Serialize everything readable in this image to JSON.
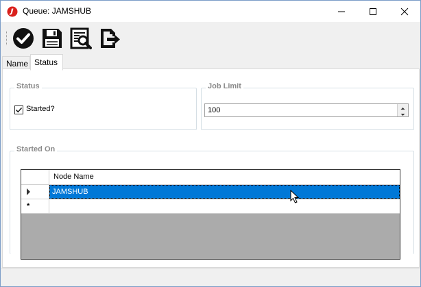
{
  "window": {
    "title": "Queue: JAMSHUB"
  },
  "titlebar_buttons": [
    {
      "name": "minimize"
    },
    {
      "name": "maximize"
    },
    {
      "name": "close"
    }
  ],
  "toolbar": {
    "items": [
      {
        "icon": "checkmark-icon"
      },
      {
        "icon": "save-icon"
      },
      {
        "icon": "search-report-icon"
      },
      {
        "icon": "export-icon"
      }
    ]
  },
  "tabs": [
    {
      "label": "Name",
      "active": false
    },
    {
      "label": "Status",
      "active": true
    }
  ],
  "status_group": {
    "title": "Status",
    "started_checkbox": {
      "label": "Started?",
      "checked": true
    }
  },
  "job_limit_group": {
    "title": "Job Limit",
    "value": "100"
  },
  "started_on_group": {
    "title": "Started On",
    "grid": {
      "columns": [
        "Node Name"
      ],
      "rows": [
        {
          "node_name": "JAMSHUB",
          "selected": true,
          "row_marker": "current"
        }
      ],
      "new_row_marker": "*"
    }
  },
  "colors": {
    "accent": "#0078d7",
    "group_label": "#8a8a8a",
    "grid_background": "#ababab",
    "app_icon": "#d9201c"
  }
}
